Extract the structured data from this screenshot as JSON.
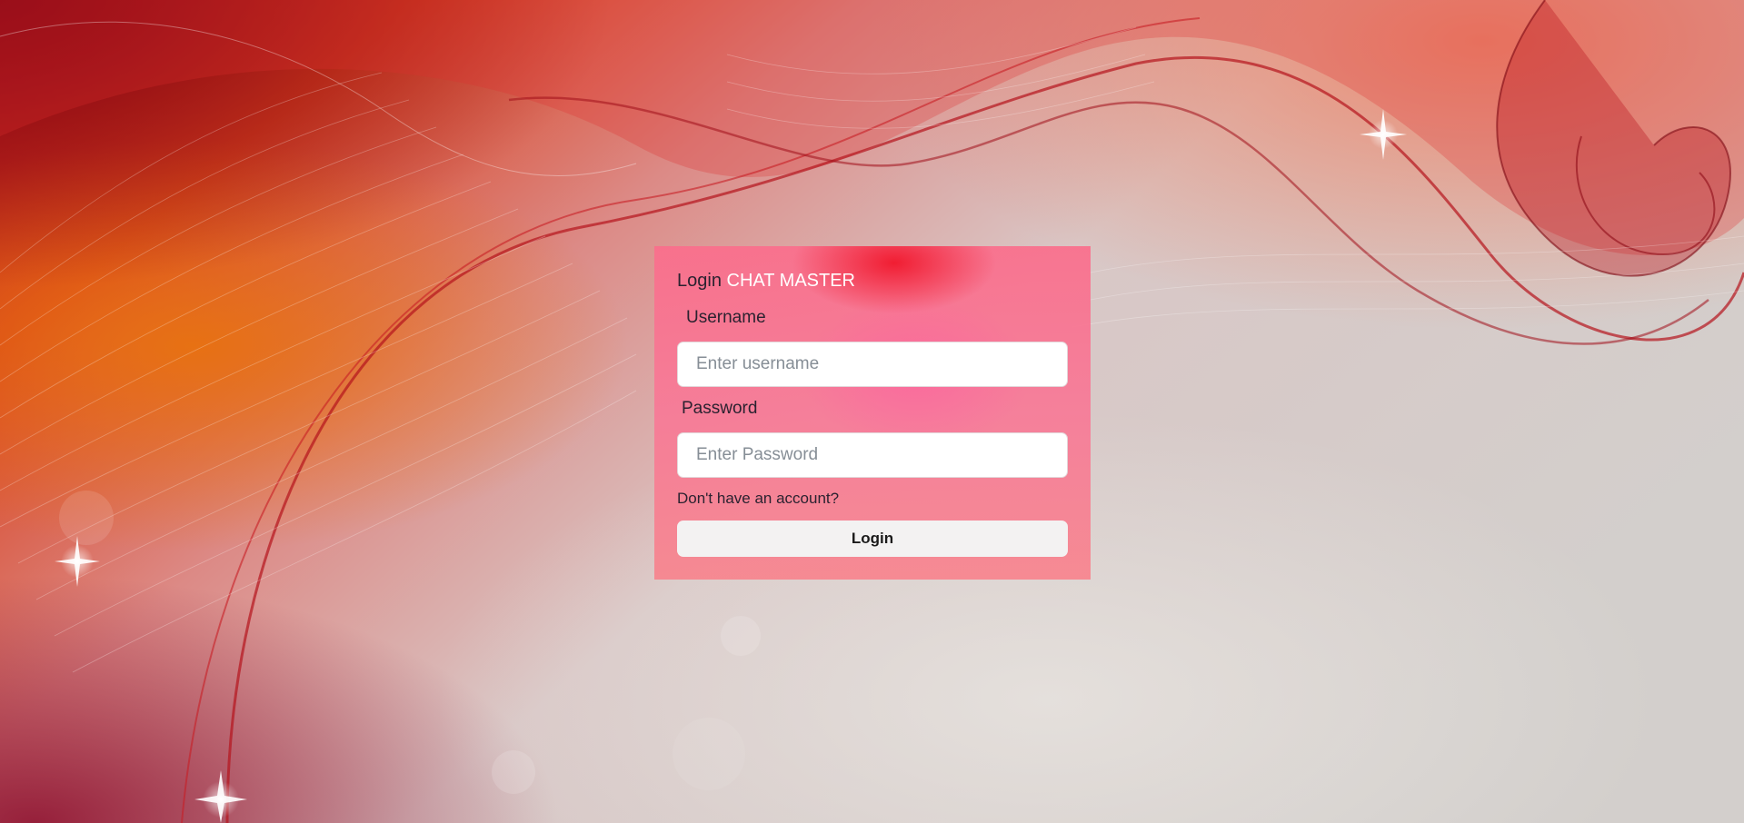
{
  "login": {
    "title_prefix": "Login",
    "title_brand": "CHAT MASTER",
    "username_label": "Username",
    "username_placeholder": "Enter username",
    "username_value": "",
    "password_label": "Password",
    "password_placeholder": "Enter Password",
    "password_value": "",
    "signup_link": "Don't have an account?",
    "submit_label": "Login"
  },
  "theme": {
    "card_background": "#f87a96",
    "brand_text_color": "#ffffff",
    "button_background": "#f3f2f2",
    "page_background_primary": "#c8201e",
    "page_background_secondary": "#d6cfcd"
  }
}
